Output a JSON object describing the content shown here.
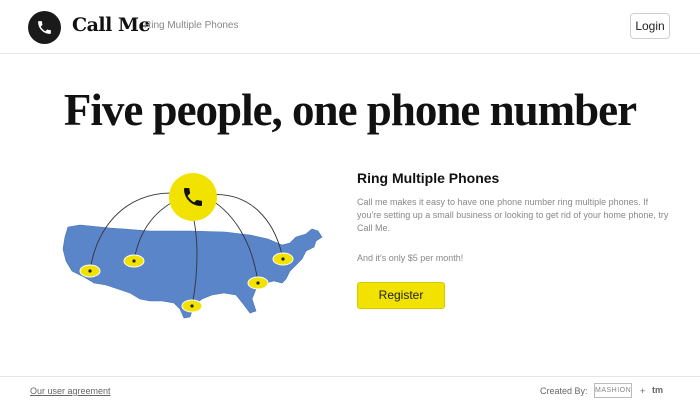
{
  "header": {
    "brand": "Call Me",
    "tagline": "Ring Multiple Phones",
    "login_label": "Login"
  },
  "hero": {
    "headline": "Five people, one phone number"
  },
  "feature": {
    "title": "Ring Multiple Phones",
    "description": "Call me makes it easy to have one phone number ring multiple phones. If you're setting up a small business or looking to get rid of your home phone, try Call Me.",
    "price_text": "And it's only $5 per month!",
    "register_label": "Register"
  },
  "footer": {
    "agreement_label": "Our user agreement",
    "created_by_label": "Created By:",
    "credit_one": "MASHION",
    "plus": "+",
    "credit_two": "tm"
  },
  "colors": {
    "accent_yellow": "#f2e200",
    "map_blue": "#5a86c9",
    "logo_dark": "#1a1a1a"
  },
  "icons": {
    "logo": "phone-icon",
    "map_center": "phone-icon"
  }
}
